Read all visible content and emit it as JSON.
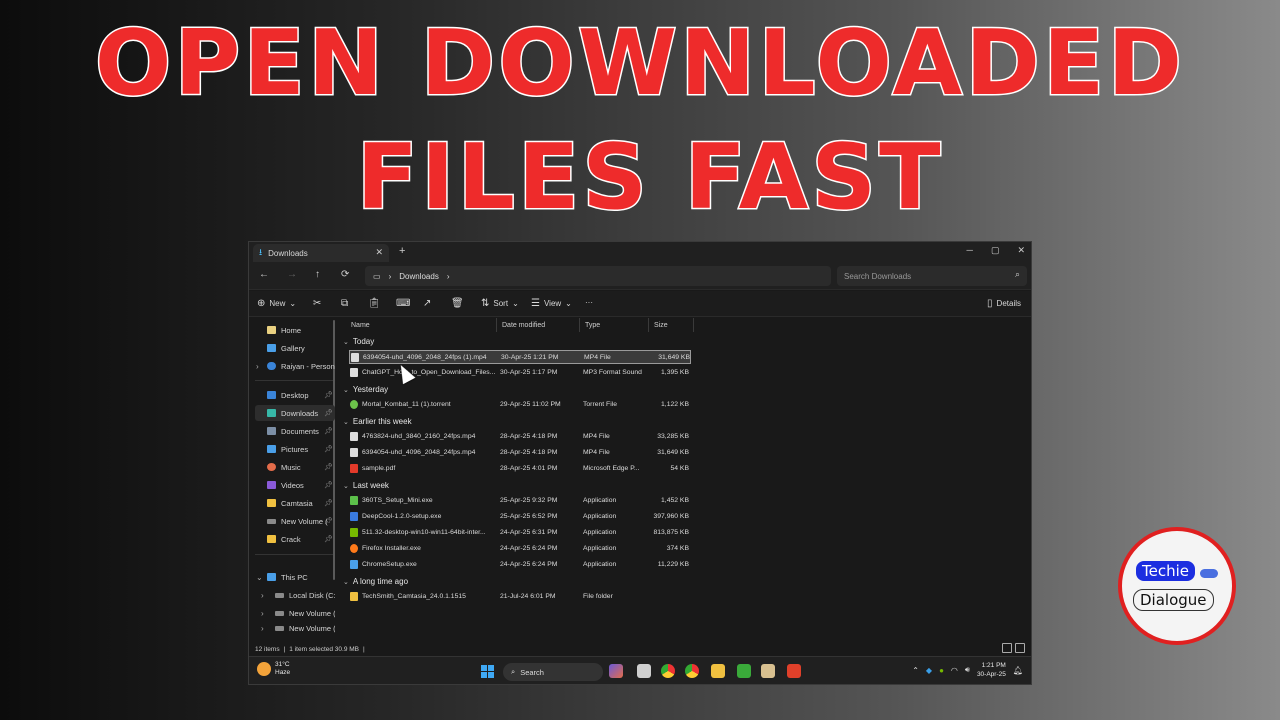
{
  "headline": {
    "line1": "OPEN DOWNLOADED",
    "line2": "FILES FAST"
  },
  "window": {
    "tab_title": "Downloads",
    "tab_close": "✕",
    "new_tab": "+",
    "controls": [
      "─",
      "▢",
      "✕"
    ]
  },
  "nav": {
    "back": "←",
    "forward": "→",
    "up": "↑",
    "refresh": "⟳",
    "breadcrumb": [
      "Downloads"
    ],
    "search_placeholder": "Search Downloads"
  },
  "toolbar": {
    "new_label": "New",
    "sort_label": "Sort",
    "view_label": "View",
    "more_label": "···",
    "details_label": "Details"
  },
  "sidebar": {
    "items": [
      {
        "label": "Home",
        "color": "#e8d080"
      },
      {
        "label": "Gallery",
        "color": "#4a9fe8"
      },
      {
        "label": "Raiyan - Personal",
        "color": "#3a84d8"
      },
      {
        "label": "Desktop",
        "color": "#3a84d8"
      },
      {
        "label": "Downloads",
        "color": "#37b8a8"
      },
      {
        "label": "Documents",
        "color": "#7c8fa6"
      },
      {
        "label": "Pictures",
        "color": "#4a9fe8"
      },
      {
        "label": "Music",
        "color": "#e46c4a"
      },
      {
        "label": "Videos",
        "color": "#8a5ad8"
      },
      {
        "label": "Camtasia",
        "color": "#f0c040"
      },
      {
        "label": "New Volume (",
        "color": "#8a8a8a"
      },
      {
        "label": "Crack",
        "color": "#f0c040"
      },
      {
        "label": "This PC",
        "color": "#4a9fe8"
      },
      {
        "label": "Local Disk (C:)",
        "color": "#8a8a8a"
      },
      {
        "label": "New Volume (I",
        "color": "#8a8a8a"
      },
      {
        "label": "New Volume (I",
        "color": "#8a8a8a"
      }
    ]
  },
  "columns": {
    "name": "Name",
    "date": "Date modified",
    "type": "Type",
    "size": "Size"
  },
  "groups": [
    "Today",
    "Yesterday",
    "Earlier this week",
    "Last week",
    "A long time ago"
  ],
  "files": [
    {
      "name": "6394054-uhd_4096_2048_24fps (1).mp4",
      "date": "30-Apr-25 1:21 PM",
      "type": "MP4 File",
      "size": "31,649 KB",
      "color": "#ddd"
    },
    {
      "name": "ChatGPT_How_to_Open_Download_Files...",
      "date": "30-Apr-25 1:17 PM",
      "type": "MP3 Format Sound",
      "size": "1,395 KB",
      "color": "#ddd"
    },
    {
      "name": "Mortal_Kombat_11 (1).torrent",
      "date": "29-Apr-25 11:02 PM",
      "type": "Torrent File",
      "size": "1,122 KB",
      "color": "#6cc24a"
    },
    {
      "name": "4763824-uhd_3840_2160_24fps.mp4",
      "date": "28-Apr-25 4:18 PM",
      "type": "MP4 File",
      "size": "33,285 KB",
      "color": "#ddd"
    },
    {
      "name": "6394054-uhd_4096_2048_24fps.mp4",
      "date": "28-Apr-25 4:18 PM",
      "type": "MP4 File",
      "size": "31,649 KB",
      "color": "#ddd"
    },
    {
      "name": "sample.pdf",
      "date": "28-Apr-25 4:01 PM",
      "type": "Microsoft Edge P...",
      "size": "54 KB",
      "color": "#e33a2a"
    },
    {
      "name": "360TS_Setup_Mini.exe",
      "date": "25-Apr-25 9:32 PM",
      "type": "Application",
      "size": "1,452 KB",
      "color": "#5cc04a"
    },
    {
      "name": "DeepCool-1.2.0-setup.exe",
      "date": "25-Apr-25 6:52 PM",
      "type": "Application",
      "size": "397,960 KB",
      "color": "#3a7be0"
    },
    {
      "name": "511.32-desktop-win10-win11-64bit-inter...",
      "date": "24-Apr-25 6:31 PM",
      "type": "Application",
      "size": "813,875 KB",
      "color": "#76b900"
    },
    {
      "name": "Firefox Installer.exe",
      "date": "24-Apr-25 6:24 PM",
      "type": "Application",
      "size": "374 KB",
      "color": "#ff7a1a"
    },
    {
      "name": "ChromeSetup.exe",
      "date": "24-Apr-25 6:24 PM",
      "type": "Application",
      "size": "11,229 KB",
      "color": "#4a9fe8"
    },
    {
      "name": "TechSmith_Camtasia_24.0.1.1515",
      "date": "21-Jul-24 6:01 PM",
      "type": "File folder",
      "size": "",
      "color": "#f0c040"
    }
  ],
  "status": {
    "items": "12 items",
    "selected": "1 item selected  30.9 MB"
  },
  "taskbar": {
    "temp": "31°C",
    "weather": "Haze",
    "search": "Search",
    "time": "1:21 PM",
    "date": "30-Apr-25"
  },
  "logo": {
    "line1": "Techie",
    "line2": "Dialogue"
  }
}
